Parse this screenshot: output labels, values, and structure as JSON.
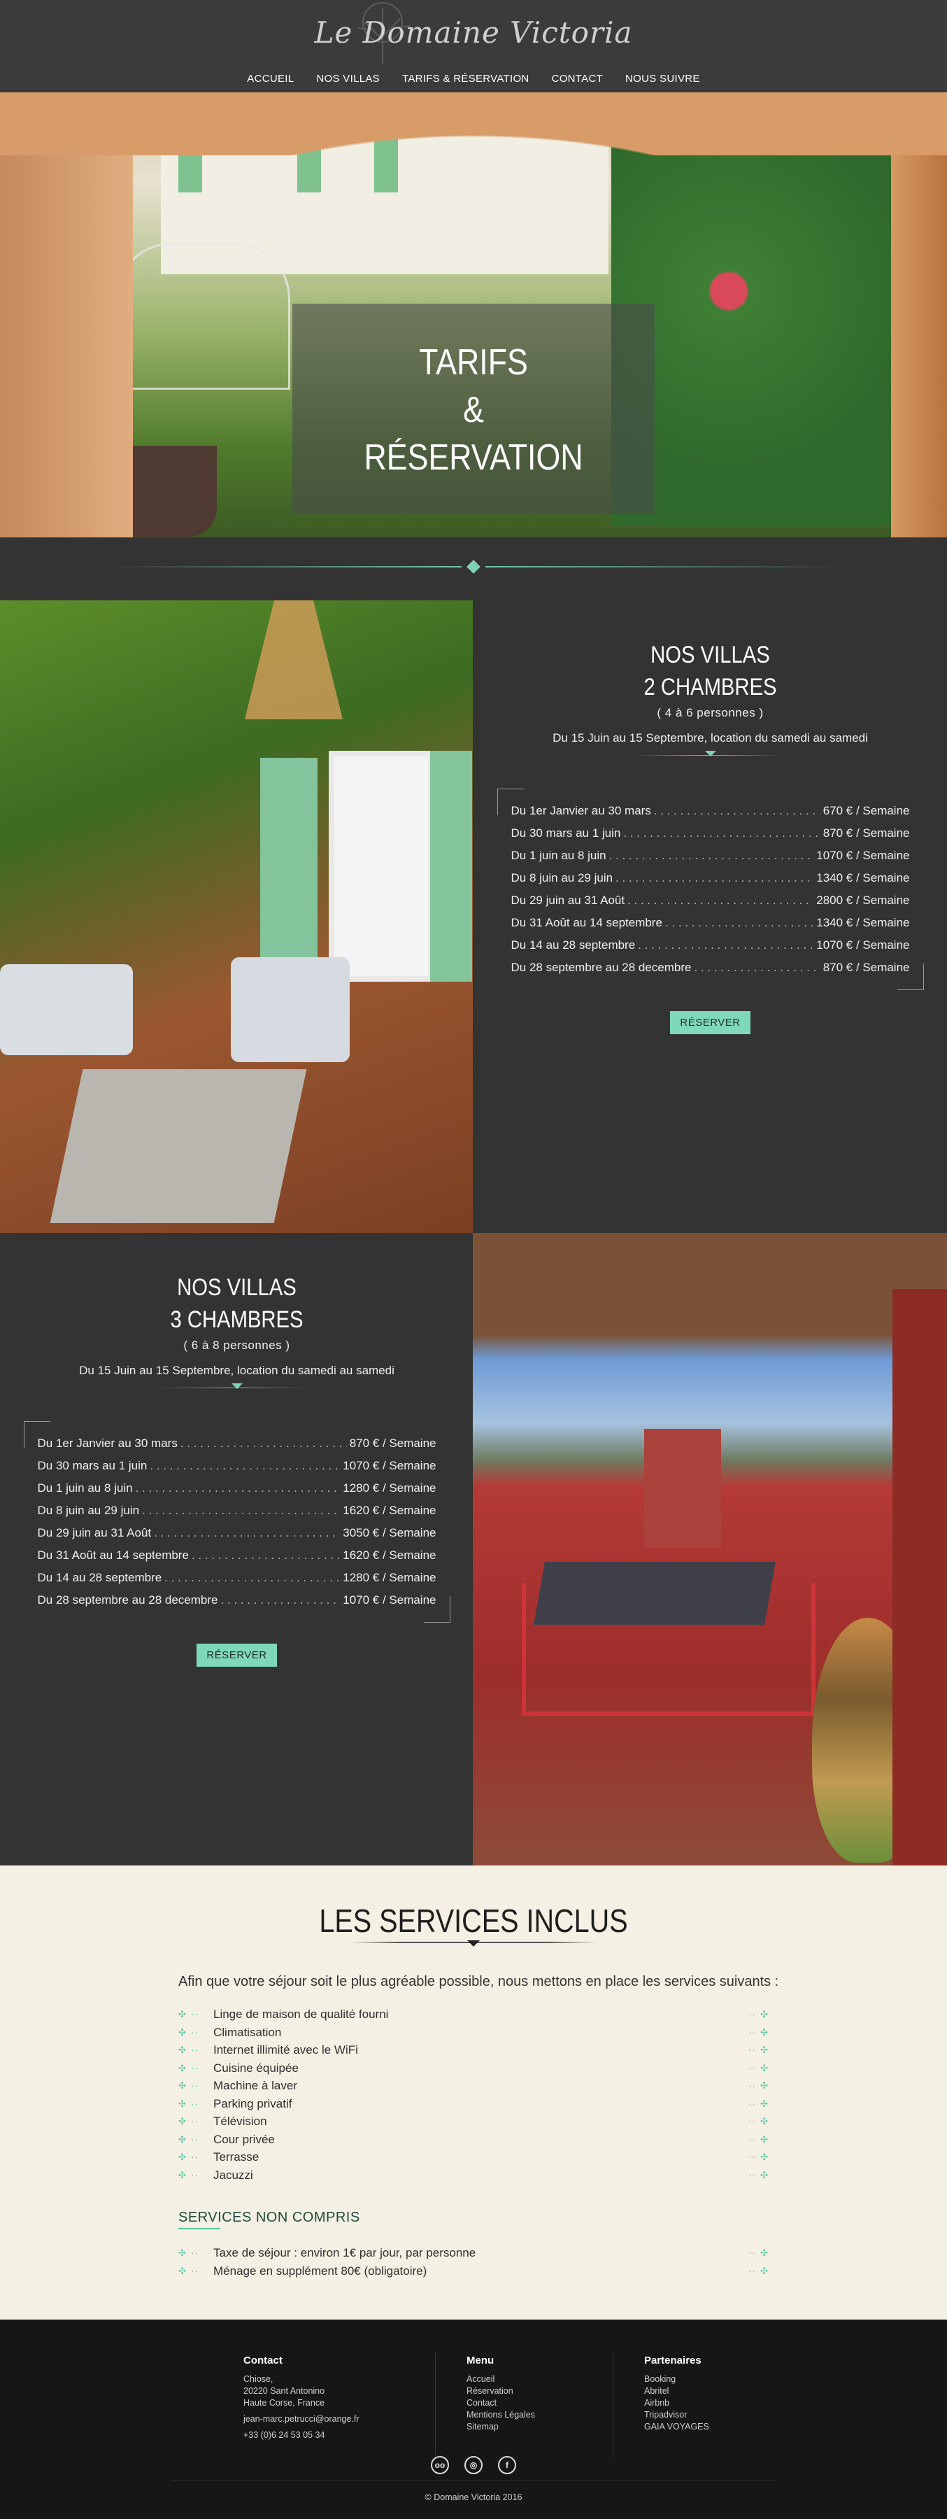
{
  "brand": {
    "logo_text": "Le Domaine Victoria"
  },
  "nav": {
    "items": [
      "ACCUEIL",
      "NOS VILLAS",
      "TARIFS & RÉSERVATION",
      "CONTACT",
      "NOUS SUIVRE"
    ]
  },
  "hero": {
    "line1": "TARIFS",
    "line2": "&",
    "line3": "RÉSERVATION"
  },
  "villa2": {
    "title1": "NOS VILLAS",
    "title2": "2 CHAMBRES",
    "persons": "( 4 à 6 personnes )",
    "season": "Du 15 Juin au 15 Septembre, location du samedi au samedi",
    "rates": [
      {
        "period": "Du 1er Janvier au 30 mars",
        "price": "670 € / Semaine"
      },
      {
        "period": "Du 30 mars au 1 juin",
        "price": "870 € / Semaine"
      },
      {
        "period": "Du 1 juin au 8 juin",
        "price": "1070 € / Semaine"
      },
      {
        "period": "Du 8 juin au 29 juin",
        "price": "1340 € / Semaine"
      },
      {
        "period": "Du 29 juin au 31 Août",
        "price": "2800 € / Semaine"
      },
      {
        "period": "Du 31 Août au 14 septembre",
        "price": "1340 € / Semaine"
      },
      {
        "period": "Du 14 au 28 septembre",
        "price": "1070 € / Semaine"
      },
      {
        "period": "Du 28 septembre au 28 decembre",
        "price": "870 € / Semaine"
      }
    ],
    "button": "RÉSERVER"
  },
  "villa3": {
    "title1": "NOS VILLAS",
    "title2": "3 CHAMBRES",
    "persons": "( 6 à 8 personnes )",
    "season": "Du 15 Juin au 15 Septembre, location du samedi au samedi",
    "rates": [
      {
        "period": "Du 1er Janvier au 30 mars",
        "price": "870 € / Semaine"
      },
      {
        "period": "Du 30 mars au 1 juin",
        "price": "1070 € / Semaine"
      },
      {
        "period": "Du 1 juin au 8 juin",
        "price": "1280 € / Semaine"
      },
      {
        "period": "Du 8 juin au 29 juin",
        "price": "1620 € / Semaine"
      },
      {
        "period": "Du 29 juin au 31 Août",
        "price": "3050 € / Semaine"
      },
      {
        "period": "Du 31 Août au 14 septembre",
        "price": "1620 € / Semaine"
      },
      {
        "period": "Du 14 au 28 septembre",
        "price": "1280 € / Semaine"
      },
      {
        "period": "Du 28 septembre au 28 decembre",
        "price": "1070 € / Semaine"
      }
    ],
    "button": "RÉSERVER"
  },
  "services": {
    "title": "LES SERVICES INCLUS",
    "intro": "Afin que votre séjour soit le plus agréable possible, nous mettons en place les services suivants :",
    "items": [
      "Linge de maison de qualité fourni",
      "Climatisation",
      "Internet illimité avec le WiFi",
      "Cuisine équipée",
      "Machine à laver",
      "Parking privatif",
      "Télévision",
      "Cour privée",
      "Terrasse",
      "Jacuzzi"
    ],
    "not_included_title": "SERVICES NON COMPRIS",
    "not_included": [
      "Taxe de séjour : environ 1€ par jour, par personne",
      "Ménage en supplément 80€ (obligatoire)"
    ],
    "ornament_left": "✣ ∙∙",
    "ornament_right": "∙∙ ✣"
  },
  "footer": {
    "contact": {
      "title": "Contact",
      "name": "Chiose,",
      "addr1": "20220 Sant Antonino",
      "addr2": "Haute Corse, France",
      "email": "jean-marc.petrucci@orange.fr",
      "phone": "+33 (0)6 24 53 05 34"
    },
    "menu": {
      "title": "Menu",
      "items": [
        "Accueil",
        "Réservation",
        "Contact",
        "Mentions Légales",
        "Sitemap"
      ]
    },
    "partners": {
      "title": "Partenaires",
      "items": [
        "Booking",
        "Abritel",
        "Airbnb",
        "Tripadvisor",
        "GAIA VOYAGES"
      ]
    },
    "social": [
      "tripadvisor-icon",
      "instagram-icon",
      "facebook-icon"
    ],
    "copyright": "© Domaine Victoria 2016"
  },
  "colors": {
    "accent": "#7fd8b9",
    "dark": "#333333",
    "cream": "#f4f0e4",
    "footer": "#161616"
  }
}
